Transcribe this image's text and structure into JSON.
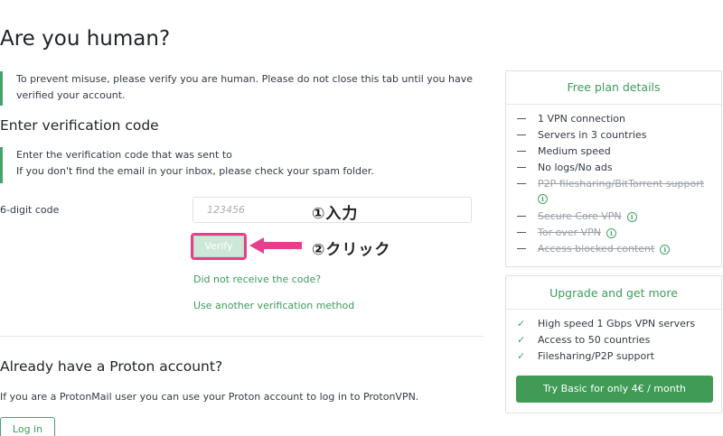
{
  "page": {
    "title": "Are you human?"
  },
  "notice": {
    "line1": "To prevent misuse, please verify you are human. Please do not close this tab until you have",
    "line2": "verified your account."
  },
  "verification": {
    "heading": "Enter verification code",
    "notice_line1": "Enter the verification code that was sent to",
    "notice_line2": "If you don't find the email in your inbox, please check your spam folder.",
    "code_label": "6-digit code",
    "code_placeholder": "123456",
    "code_value": "",
    "verify_label": "Verify",
    "resend_link": "Did not receive the code?",
    "other_method_link": "Use another verification method"
  },
  "annotations": {
    "step1": "①入力",
    "step2": "②クリック",
    "highlight_color": "#e83e8c"
  },
  "account": {
    "heading": "Already have a Proton account?",
    "text": "If you are a ProtonMail user you can use your Proton account to log in to ProtonVPN.",
    "login_label": "Log in"
  },
  "free_plan": {
    "title": "Free plan details",
    "features": [
      {
        "label": "1 VPN connection",
        "available": true,
        "info": false
      },
      {
        "label": "Servers in 3 countries",
        "available": true,
        "info": false
      },
      {
        "label": "Medium speed",
        "available": true,
        "info": false
      },
      {
        "label": "No logs/No ads",
        "available": true,
        "info": false
      },
      {
        "label": "P2P filesharing/BitTorrent support",
        "available": false,
        "info": true
      },
      {
        "label": "Secure Core VPN",
        "available": false,
        "info": true
      },
      {
        "label": "Tor over VPN",
        "available": false,
        "info": true
      },
      {
        "label": "Access blocked content",
        "available": false,
        "info": true
      }
    ],
    "info_icon": "info-circle-icon"
  },
  "upgrade": {
    "title": "Upgrade and get more",
    "features": [
      "High speed 1 Gbps VPN servers",
      "Access to 50 countries",
      "Filesharing/P2P support"
    ],
    "cta_label": "Try Basic for only 4€ / month",
    "check_icon": "check-icon"
  },
  "colors": {
    "accent": "#44a26a",
    "link": "#3c9b5b",
    "cta": "#3f9b55",
    "disabled_button": "#cde8d6"
  }
}
